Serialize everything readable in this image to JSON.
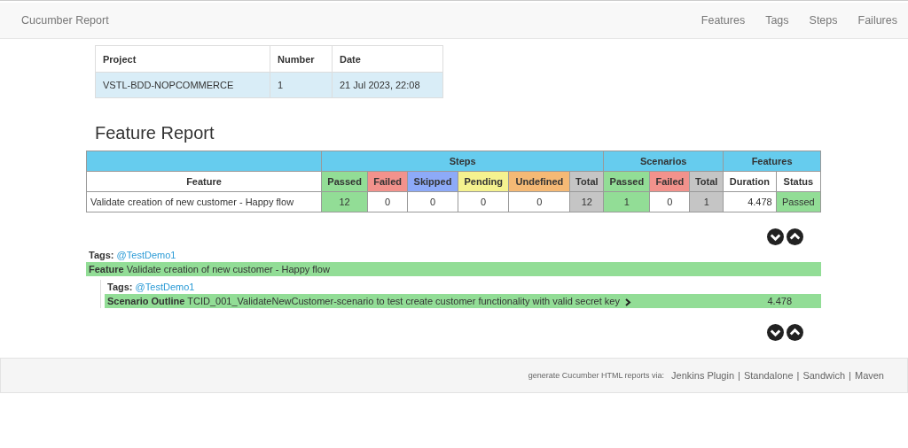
{
  "navbar": {
    "brand": "Cucumber Report",
    "links": [
      "Features",
      "Tags",
      "Steps",
      "Failures"
    ]
  },
  "project_table": {
    "columns": [
      "Project",
      "Number",
      "Date"
    ],
    "rows": [
      [
        "VSTL-BDD-NOPCOMMERCE",
        "1",
        "21 Jul 2023, 22:08"
      ]
    ]
  },
  "feature_report": {
    "title": "Feature Report",
    "groups": [
      {
        "columns": [
          {
            "label": "Feature",
            "kind": "plain"
          }
        ]
      },
      {
        "label": "Steps",
        "columns": [
          {
            "label": "Passed",
            "kind": "passed"
          },
          {
            "label": "Failed",
            "kind": "failed"
          },
          {
            "label": "Skipped",
            "kind": "skipped"
          },
          {
            "label": "Pending",
            "kind": "pending"
          },
          {
            "label": "Undefined",
            "kind": "undefined"
          },
          {
            "label": "Total",
            "kind": "total"
          }
        ]
      },
      {
        "label": "Scenarios",
        "columns": [
          {
            "label": "Passed",
            "kind": "passed"
          },
          {
            "label": "Failed",
            "kind": "failed"
          },
          {
            "label": "Total",
            "kind": "total"
          }
        ]
      },
      {
        "label": "Features",
        "columns": [
          {
            "label": "Duration",
            "kind": "plain"
          },
          {
            "label": "Status",
            "kind": "plain"
          }
        ]
      }
    ],
    "rows": [
      [
        {
          "value": "Validate creation of new customer - Happy flow",
          "kind": "name"
        },
        {
          "value": "12",
          "kind": "passed"
        },
        {
          "value": "0",
          "kind": "plain"
        },
        {
          "value": "0",
          "kind": "plain"
        },
        {
          "value": "0",
          "kind": "plain"
        },
        {
          "value": "0",
          "kind": "plain"
        },
        {
          "value": "12",
          "kind": "total"
        },
        {
          "value": "1",
          "kind": "passed"
        },
        {
          "value": "0",
          "kind": "plain"
        },
        {
          "value": "1",
          "kind": "total"
        },
        {
          "value": "4.478",
          "kind": "duration"
        },
        {
          "value": "Passed",
          "kind": "passed"
        }
      ]
    ]
  },
  "details": {
    "tags_label": "Tags:",
    "tag": "@TestDemo1",
    "keyword": "Feature",
    "name": "Validate creation of new customer - Happy flow",
    "kind": "passed",
    "elements": [
      {
        "tags_label": "Tags:",
        "tag": "@TestDemo1",
        "keyword": "Scenario Outline",
        "name": "TCID_001_ValidateNewCustomer-scenario to test create customer functionality with valid secret key",
        "duration": "4.478",
        "kind": "passed"
      }
    ]
  },
  "footer": {
    "text": "generate Cucumber HTML reports via:",
    "separator": "|",
    "links": [
      "Jenkins Plugin",
      "Standalone",
      "Sandwich",
      "Maven"
    ]
  }
}
